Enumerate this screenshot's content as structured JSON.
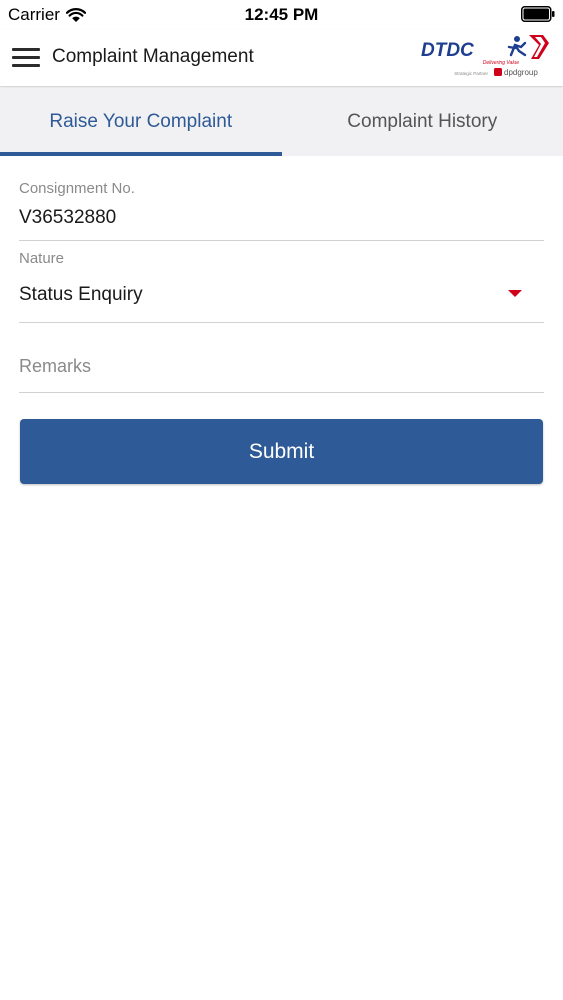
{
  "status_bar": {
    "carrier": "Carrier",
    "time": "12:45 PM",
    "wifi_icon": "wifi-icon",
    "battery_icon": "battery-icon"
  },
  "header": {
    "menu_icon": "hamburger-menu-icon",
    "title": "Complaint Management",
    "logo": {
      "brand": "DTDC",
      "tagline": "Delivering Value",
      "partner_prefix": "Strategic Partner",
      "partner": "dpdgroup",
      "brand_color": "#1e3f8f",
      "accent_color": "#d0021b"
    }
  },
  "tabs": [
    {
      "label": "Raise Your Complaint",
      "active": true
    },
    {
      "label": "Complaint History",
      "active": false
    }
  ],
  "form": {
    "consignment": {
      "label": "Consignment No.",
      "value": "V36532880"
    },
    "nature": {
      "label": "Nature",
      "value": "Status Enquiry"
    },
    "remarks": {
      "placeholder": "Remarks",
      "value": ""
    },
    "submit_label": "Submit"
  },
  "colors": {
    "primary": "#2e5a97",
    "tab_background": "#f1f1f3",
    "dropdown_arrow": "#d0021b"
  }
}
